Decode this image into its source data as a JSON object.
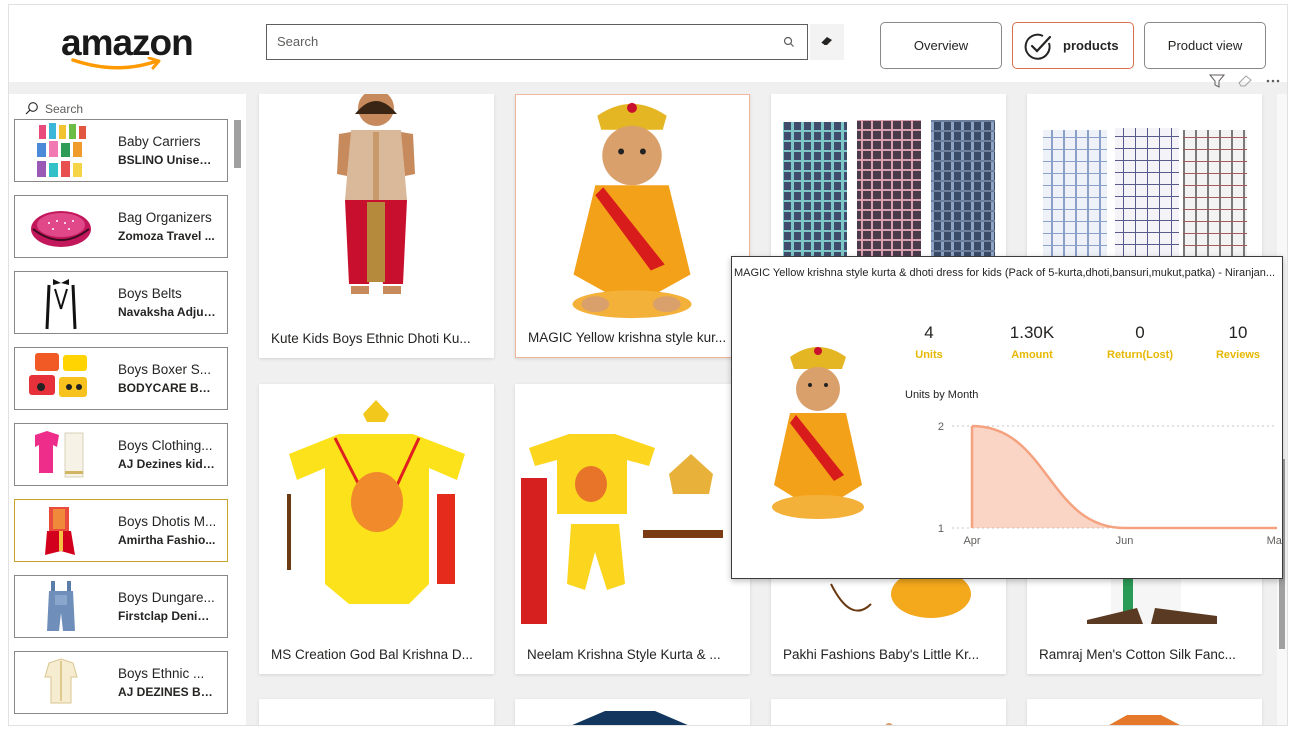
{
  "header": {
    "logo_text": "amazon",
    "search_placeholder": "Search",
    "nav": {
      "overview": "Overview",
      "products": "products",
      "product_view": "Product view"
    }
  },
  "slicer": {
    "search_placeholder": "Search",
    "items": [
      {
        "title": "Baby Carriers",
        "sub": "BSLINO Unisex ..."
      },
      {
        "title": "Bag Organizers",
        "sub": "Zomoza Travel ..."
      },
      {
        "title": "Boys Belts",
        "sub": "Navaksha Adjus..."
      },
      {
        "title": "Boys Boxer S...",
        "sub": "BODYCARE Box..."
      },
      {
        "title": "Boys Clothing...",
        "sub": "AJ Dezines kids ..."
      },
      {
        "title": "Boys Dhotis M...",
        "sub": "Amirtha Fashio..."
      },
      {
        "title": "Boys Dungare...",
        "sub": "Firstclap Denim ..."
      },
      {
        "title": "Boys Ethnic ...",
        "sub": "AJ DEZINES Boy..."
      }
    ]
  },
  "products": [
    {
      "label": "Kute Kids Boys Ethnic Dhoti Ku..."
    },
    {
      "label": "MAGIC Yellow krishna style kur..."
    },
    {
      "label": ""
    },
    {
      "label": ""
    },
    {
      "label": "MS Creation God Bal Krishna D..."
    },
    {
      "label": "Neelam Krishna Style Kurta & ..."
    },
    {
      "label": "Pakhi Fashions Baby's Little Kr..."
    },
    {
      "label": "Ramraj Men's Cotton Silk Fanc..."
    }
  ],
  "tooltip": {
    "title": "MAGIC Yellow krishna style kurta & dhoti dress for kids (Pack of 5-kurta,dhoti,bansuri,mukut,patka) - Niranjan...",
    "kpis": [
      {
        "value": "4",
        "label": "Units"
      },
      {
        "value": "1.30K",
        "label": "Amount"
      },
      {
        "value": "0",
        "label": "Return(Lost)"
      },
      {
        "value": "10",
        "label": "Reviews"
      }
    ],
    "chart_title": "Units by Month"
  },
  "chart_data": {
    "type": "area",
    "title": "Units by Month",
    "categories": [
      "Apr",
      "Jun",
      "May"
    ],
    "values": [
      2,
      1,
      1
    ],
    "yticks": [
      1,
      2
    ],
    "ylim": [
      1,
      2
    ],
    "color": "#f4a27f",
    "grid": true
  },
  "colors": {
    "accent": "#d9704a",
    "kpi_label": "#e6b800",
    "selected_border": "#c9a227"
  }
}
